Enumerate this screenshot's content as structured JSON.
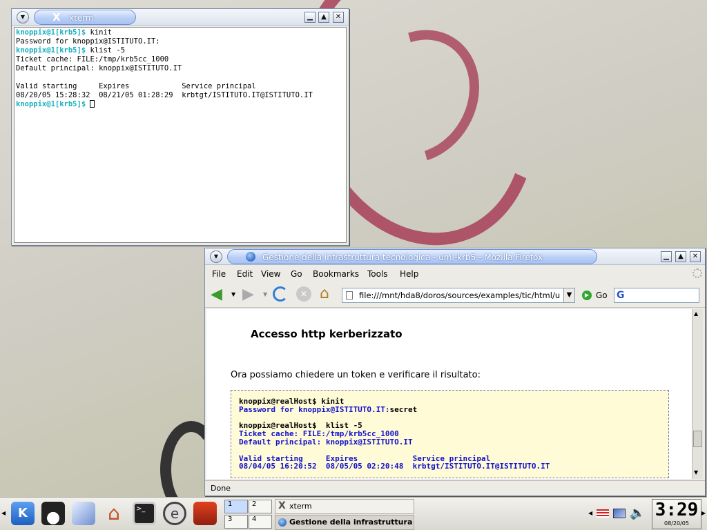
{
  "xterm": {
    "title": "xterm",
    "lines": [
      {
        "prompt": "knoppix@1[krb5]$",
        "cmd": " kinit"
      },
      {
        "text": "Password for knoppix@ISTITUTO.IT:"
      },
      {
        "prompt": "knoppix@1[krb5]$",
        "cmd": " klist -5"
      },
      {
        "text": "Ticket cache: FILE:/tmp/krb5cc_1000"
      },
      {
        "text": "Default principal: knoppix@ISTITUTO.IT"
      },
      {
        "text": ""
      },
      {
        "text": "Valid starting     Expires            Service principal"
      },
      {
        "text": "08/20/05 15:28:32  08/21/05 01:28:29  krbtgt/ISTITUTO.IT@ISTITUTO.IT"
      },
      {
        "prompt": "knoppix@1[krb5]$",
        "cmd": " "
      }
    ]
  },
  "firefox": {
    "title": "Gestione della infrastruttura tecnologica - uml-krb5 - Mozilla Firefox",
    "menu": [
      "File",
      "Edit",
      "View",
      "Go",
      "Bookmarks",
      "Tools",
      "Help"
    ],
    "url": "file:///mnt/hda8/doros/sources/examples/tic/html/u",
    "go_label": "Go",
    "heading": "Accesso http kerberizzato",
    "paragraph": "Ora possiamo chiedere un token e verificare il risultato:",
    "pre_lines": [
      {
        "a": "knoppix@realHost$ kinit",
        "b": ""
      },
      {
        "a": "Password for knoppix@ISTITUTO.IT:",
        "b": "secret",
        "blue": true
      },
      {
        "a": "",
        "b": ""
      },
      {
        "a": "knoppix@realHost$  klist -5",
        "b": ""
      },
      {
        "a": "Ticket cache: FILE:/tmp/krb5cc_1000",
        "b": "",
        "blue": true
      },
      {
        "a": "Default principal: knoppix@ISTITUTO.IT",
        "b": "",
        "blue": true
      },
      {
        "a": "",
        "b": ""
      },
      {
        "a": "Valid starting     Expires            Service principal",
        "b": "",
        "blue": true
      },
      {
        "a": "08/04/05 16:20:52  08/05/05 02:20:48  krbtgt/ISTITUTO.IT@ISTITUTO.IT",
        "b": "",
        "blue": true
      }
    ],
    "status": "Done"
  },
  "taskbar": {
    "pager": [
      "1",
      "2",
      "3",
      "4"
    ],
    "tasks": [
      "xterm",
      "Gestione della infrastruttura tecnologica"
    ],
    "clock_time": "3:29",
    "clock_date": "08/20/05"
  }
}
